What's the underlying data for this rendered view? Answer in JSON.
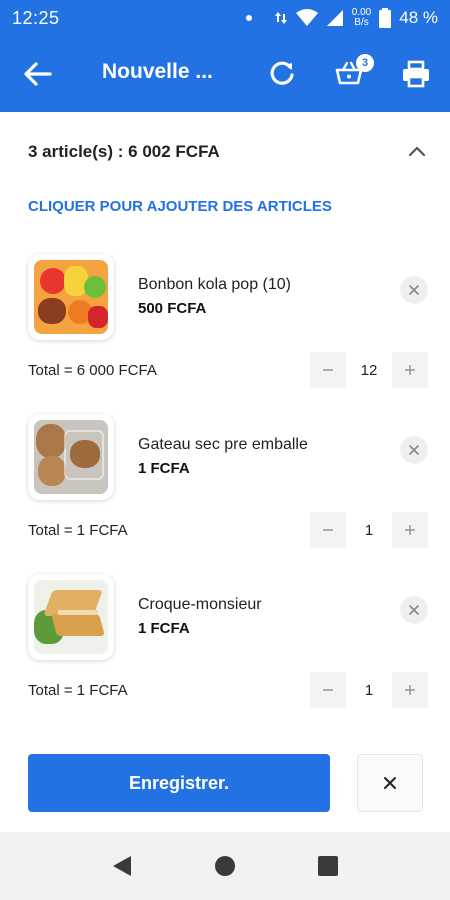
{
  "status_bar": {
    "time": "12:25",
    "speed_top": "0.00",
    "speed_bottom": "B/s",
    "battery": "48 %"
  },
  "app_bar": {
    "title": "Nouvelle ...",
    "cart_badge": "3"
  },
  "summary": {
    "text": "3 article(s) : 6 002 FCFA"
  },
  "add_link": "CLIQUER POUR AJOUTER DES ARTICLES",
  "items": [
    {
      "name": "Bonbon kola pop (10)",
      "price": "500 FCFA",
      "total": "Total = 6 000 FCFA",
      "qty": "12"
    },
    {
      "name": "Gateau sec pre emballe",
      "price": "1 FCFA",
      "total": "Total = 1 FCFA",
      "qty": "1"
    },
    {
      "name": "Croque-monsieur",
      "price": "1 FCFA",
      "total": "Total = 1 FCFA",
      "qty": "1"
    }
  ],
  "actions": {
    "save_label": "Enregistrer."
  },
  "colors": {
    "primary": "#2272e3",
    "background": "#ffffff",
    "stepper_bg": "#f3f3f3"
  }
}
